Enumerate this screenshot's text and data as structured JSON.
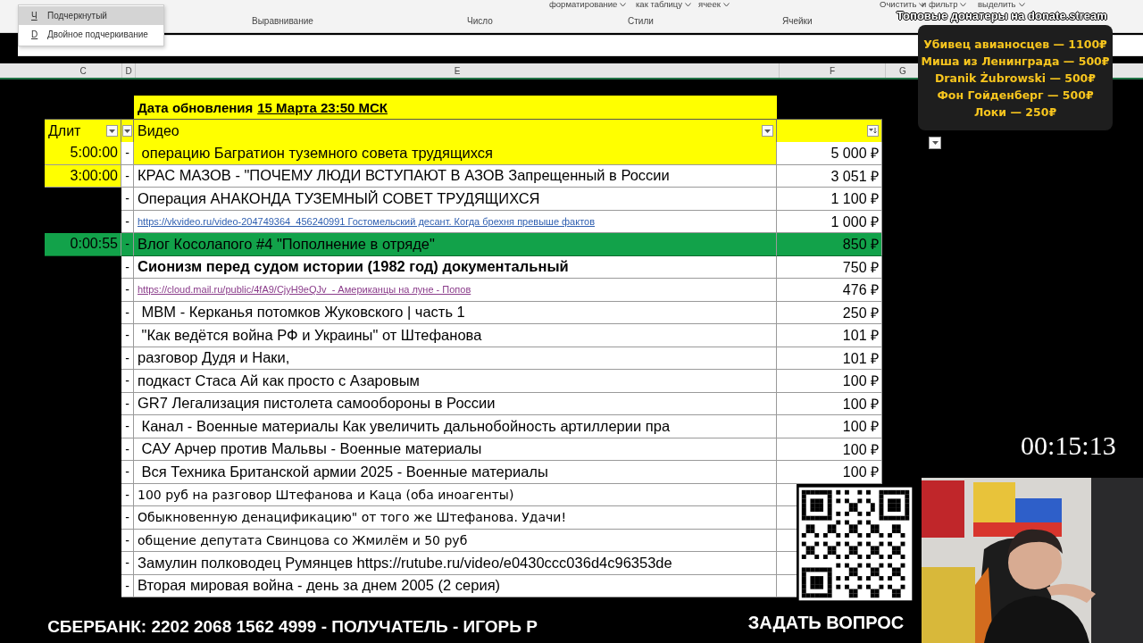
{
  "ribbon": {
    "top_items": [
      "форматирование",
      "как таблицу",
      "ячеек",
      "Очистить",
      "и фильтр",
      "выделить"
    ],
    "groups": [
      "Выравнивание",
      "Число",
      "Стили",
      "Ячейки"
    ]
  },
  "menu": {
    "items": [
      {
        "key": "Ч",
        "label": "Подчеркнутый",
        "selected": true
      },
      {
        "key": "D",
        "label": "Двойное подчеркивание",
        "selected": false
      }
    ]
  },
  "columns": [
    "C",
    "D",
    "E",
    "F",
    "G"
  ],
  "table": {
    "title_label": "Дата обновления",
    "title_date": "15 Марта 23:50 МСК",
    "headers": [
      "Длит",
      "Видео"
    ],
    "rows": [
      {
        "duration": "5:00:00",
        "dash": "-",
        "title": " операцию Багратион туземного совета трудящихся",
        "amount": "5 000 ₽",
        "kind": "plain",
        "highlight": true,
        "selected": false
      },
      {
        "duration": "3:00:00",
        "dash": "-",
        "title": "КРАС МАЗОВ - \"ПОЧЕМУ ЛЮДИ ВСТУПАЮТ В АЗОВ Запрещенный в России",
        "amount": "3 051 ₽",
        "kind": "plain",
        "highlight": false,
        "selected": false
      },
      {
        "dash": "-",
        "title": "Операция АНАКОНДА ТУЗЕМНЫЙ СОВЕТ ТРУДЯЩИХСЯ",
        "amount": "1 100 ₽",
        "kind": "plain",
        "highlight": false,
        "selected": false
      },
      {
        "dash": "-",
        "title": "https://vkvideo.ru/video-204749364_456240991 Гостомельский десант. Когда брехня превыше фактов",
        "amount": "1 000 ₽",
        "kind": "link",
        "highlight": false,
        "selected": false
      },
      {
        "duration": "0:00:55",
        "dash": "-",
        "title": "Влог Косолапого #4 \"Пополнение в отряде\"",
        "amount": "850 ₽",
        "kind": "plain",
        "highlight": false,
        "selected": true
      },
      {
        "dash": "-",
        "title": "Сионизм перед судом истории (1982 год) документальный",
        "amount": "750 ₽",
        "kind": "bold",
        "highlight": false,
        "selected": false
      },
      {
        "dash": "-",
        "title": "https://cloud.mail.ru/public/4fA9/CjyH9eQJv  - Американцы на луне - Попов",
        "amount": "476 ₽",
        "kind": "visited",
        "highlight": false,
        "selected": false
      },
      {
        "dash": "-",
        "title": " МВМ - Керканья потомков Жуковского | часть 1",
        "amount": "250 ₽",
        "kind": "plain",
        "highlight": false,
        "selected": false
      },
      {
        "dash": "-",
        "title": " \"Как ведётся война РФ и Украины\" от Штефанова",
        "amount": "101 ₽",
        "kind": "plain",
        "highlight": false,
        "selected": false
      },
      {
        "dash": "-",
        "title": "разговор Дудя и Наки,",
        "amount": "101 ₽",
        "kind": "plain",
        "highlight": false,
        "selected": false
      },
      {
        "dash": "-",
        "title": "подкаст Стаса Ай как просто с Азаровым",
        "amount": "100 ₽",
        "kind": "plain",
        "highlight": false,
        "selected": false
      },
      {
        "dash": "-",
        "title": "GR7 Легализация пистолета самообороны в России",
        "amount": "100 ₽",
        "kind": "plain",
        "highlight": false,
        "selected": false
      },
      {
        "dash": "-",
        "title": " Канал - Военные материалы Как увеличить дальнобойность артиллерии пра",
        "amount": "100 ₽",
        "kind": "plain",
        "highlight": false,
        "selected": false
      },
      {
        "dash": "-",
        "title": " САУ Арчер против Мальвы - Военные материалы",
        "amount": "100 ₽",
        "kind": "plain",
        "highlight": false,
        "selected": false
      },
      {
        "dash": "-",
        "title": " Вся Техника Британской армии 2025 - Военные материалы",
        "amount": "100 ₽",
        "kind": "plain",
        "highlight": false,
        "selected": false
      },
      {
        "dash": "-",
        "title": "100 руб на разговор Штефанова и Каца (оба иноагенты)",
        "kind": "note",
        "highlight": false,
        "selected": false
      },
      {
        "dash": "-",
        "title": "Обыкновенную денацификацию\" от того же Штефанова. Удачи!",
        "kind": "note",
        "highlight": false,
        "selected": false
      },
      {
        "dash": "-",
        "title": "общение депутата Свинцова со Жмилём и 50 руб",
        "kind": "note",
        "highlight": false,
        "selected": false
      },
      {
        "dash": "-",
        "title": "Замулин полководец Румянцев https://rutube.ru/video/e0430ccc036d4c96353de",
        "kind": "plain",
        "highlight": false,
        "selected": false
      },
      {
        "dash": "-",
        "title": "Вторая мировая война - день за днем 2005 (2 серия)",
        "kind": "plain",
        "highlight": false,
        "selected": false
      }
    ]
  },
  "overlay": {
    "donors_title": "Топовые донатеры на donate.stream",
    "donors": [
      "Убивец авианосцев — 1100₽",
      "Миша из Ленинграда — 500₽",
      "Dranik Żubrowski — 500₽",
      "Фон Гойденберг — 500₽",
      "Локи — 250₽"
    ],
    "timer": "00:15:13",
    "bank": "СБЕРБАНК: 2202 2068 1562 4999 - ПОЛУЧАТЕЛЬ - ИГОРЬ Р",
    "ask": "ЗАДАТЬ ВОПРОС",
    "webcam": {
      "kind": "picture"
    }
  }
}
